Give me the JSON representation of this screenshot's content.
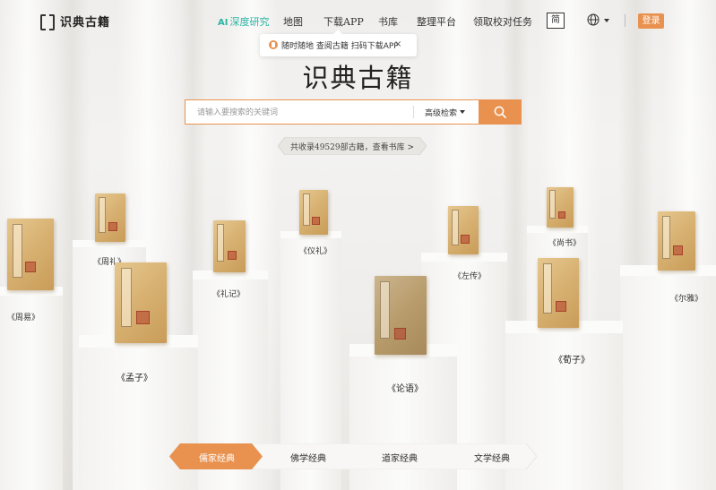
{
  "header": {
    "logo_text": "识典古籍",
    "nav": [
      {
        "label": "深度研究",
        "mark": "AI",
        "highlight": true
      },
      {
        "label": "地图"
      },
      {
        "label": "下载APP"
      },
      {
        "label": "书库"
      },
      {
        "label": "整理平台"
      },
      {
        "label": "领取校对任务"
      }
    ],
    "lang_button": "简",
    "globe_icon": "globe-icon",
    "login_label": "登录"
  },
  "tooltip": {
    "text": "随时随地 查阅古籍 扫码下载APP",
    "close": "×"
  },
  "main": {
    "title": "识典古籍",
    "search": {
      "placeholder": "请输入要搜索的关键词",
      "advanced_label": "高级检索",
      "search_icon": "search-icon"
    },
    "collection_text": "共收录49529部古籍，查看书库 >"
  },
  "books": [
    {
      "caption": "《周易》"
    },
    {
      "caption": "《周礼》"
    },
    {
      "caption": "《礼记》"
    },
    {
      "caption": "《仪礼》"
    },
    {
      "caption": "《孟子》"
    },
    {
      "caption": "《论语》"
    },
    {
      "caption": "《左传》"
    },
    {
      "caption": "《尚书》"
    },
    {
      "caption": "《荀子》"
    },
    {
      "caption": "《尔雅》"
    }
  ],
  "tabs": [
    {
      "label": "儒家经典",
      "active": true
    },
    {
      "label": "佛学经典",
      "active": false
    },
    {
      "label": "道家经典",
      "active": false
    },
    {
      "label": "文学经典",
      "active": false
    }
  ],
  "colors": {
    "accent": "#e9924f",
    "ai_teal": "#2bb3a3",
    "text": "#333333"
  }
}
